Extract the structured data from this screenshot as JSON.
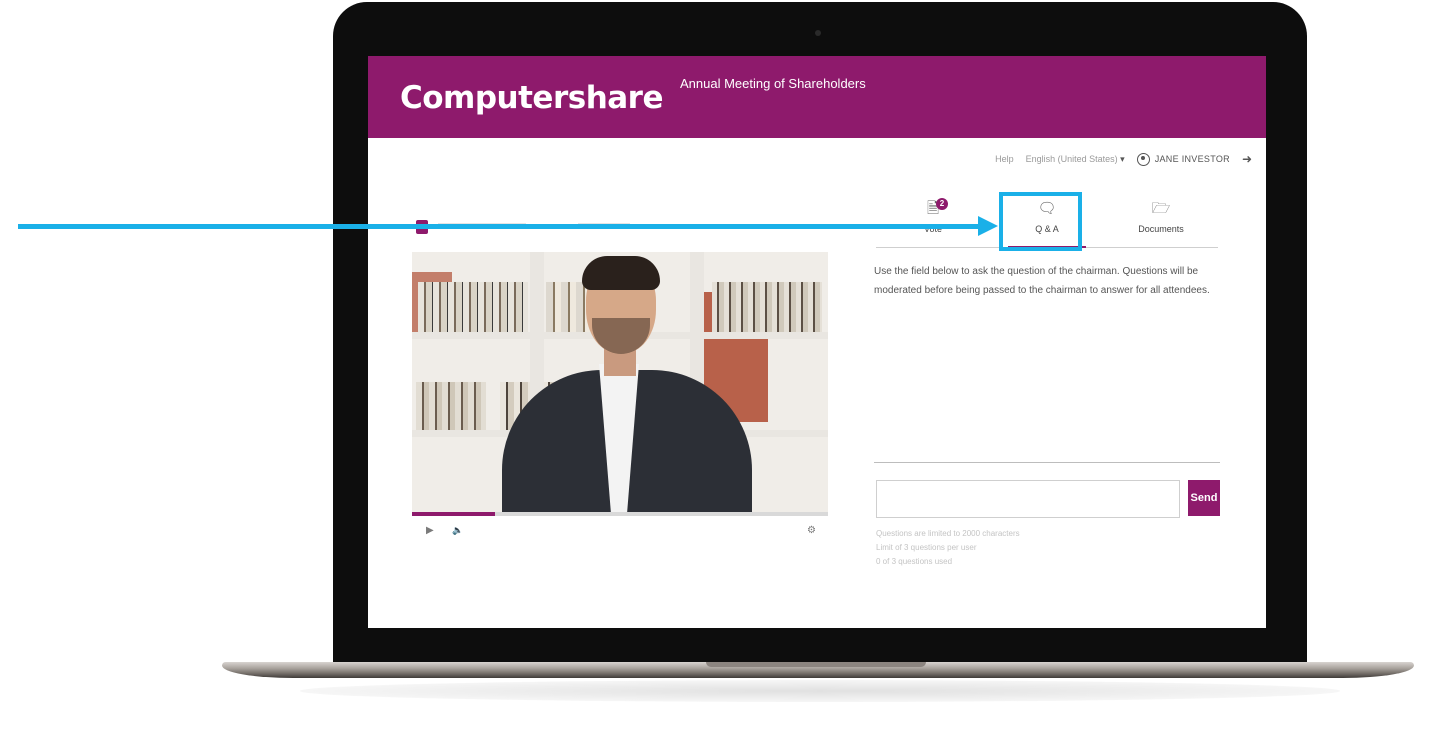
{
  "header": {
    "logo_text": "Computershare",
    "event_title": "Annual Meeting of Shareholders"
  },
  "utility": {
    "help": "Help",
    "language": "English (United States)",
    "user_name": "JANE INVESTOR"
  },
  "video": {
    "progress": 0.2
  },
  "tabs": [
    {
      "label": "Vote",
      "icon": "vote-document-icon",
      "badge": "2"
    },
    {
      "label": "Q & A",
      "icon": "speech-bubble-icon",
      "active": true
    },
    {
      "label": "Documents",
      "icon": "folder-icon"
    }
  ],
  "qa": {
    "instructions": "Use the field below to ask the question of the chairman. Questions will be moderated before being passed to the chairman to answer for all attendees.",
    "input_value": "",
    "send_label": "Send",
    "limits": [
      "Questions are limited to 2000 characters",
      "Limit of 3 questions per user",
      "0 of 3 questions used"
    ]
  },
  "colors": {
    "brand": "#8e1a6c",
    "annotation": "#1ab0e8"
  }
}
